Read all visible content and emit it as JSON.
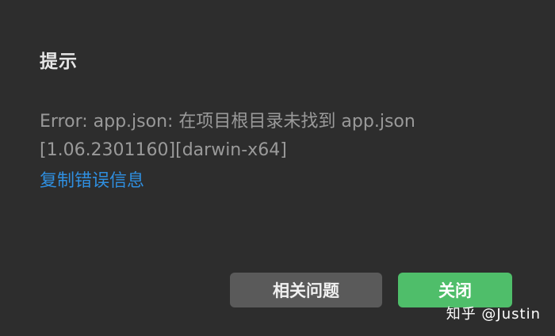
{
  "dialog": {
    "title": "提示",
    "message_line1": "Error: app.json: 在项目根目录未找到 app.json",
    "message_line2": "[1.06.2301160][darwin-x64]",
    "copy_error_link": "复制错误信息",
    "related_issues_button": "相关问题",
    "close_button": "关闭"
  },
  "watermark": {
    "text": "知乎 @Justin"
  },
  "colors": {
    "background": "#2d2d2d",
    "link": "#2f8fe0",
    "primary_button": "#4fbe6a",
    "secondary_button": "#5a5a5a"
  }
}
